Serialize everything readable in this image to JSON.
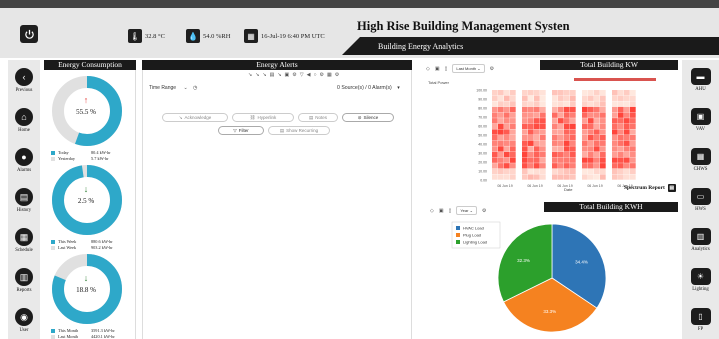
{
  "header": {
    "title": "High Rise Building Management Systen",
    "subtitle": "Building Energy Analytics",
    "temperature": "32.8 °C",
    "humidity": "54.0 %RH",
    "datetime": "16-Jul-19 6:40 PM UTC"
  },
  "left_nav": [
    {
      "label": "Previous",
      "icon": "chevron-left-icon"
    },
    {
      "label": "Home",
      "icon": "home-icon"
    },
    {
      "label": "Alarms",
      "icon": "bell-icon"
    },
    {
      "label": "History",
      "icon": "history-icon"
    },
    {
      "label": "Schedule",
      "icon": "calendar-icon"
    },
    {
      "label": "Reports",
      "icon": "reports-icon"
    },
    {
      "label": "User",
      "icon": "user-icon"
    }
  ],
  "right_nav": [
    {
      "label": "AHU",
      "icon": "ahu-icon"
    },
    {
      "label": "VAV",
      "icon": "vav-icon"
    },
    {
      "label": "CHWS",
      "icon": "chws-icon"
    },
    {
      "label": "HWS",
      "icon": "hws-icon"
    },
    {
      "label": "Analytics",
      "icon": "analytics-icon"
    },
    {
      "label": "Lighting",
      "icon": "lightbulb-icon"
    },
    {
      "label": "FP",
      "icon": "fire-panel-icon"
    }
  ],
  "energy": {
    "title": "Energy Consumption",
    "blocks": [
      {
        "percent": "55.5 %",
        "fraction": 0.555,
        "trend": "up",
        "trend_color": "#e53935",
        "rows": [
          [
            "Today",
            "80.4 kW-hr"
          ],
          [
            "Yesterday",
            "5.7 kW-hr"
          ]
        ]
      },
      {
        "percent": "2.5 %",
        "fraction": 0.975,
        "trend": "down",
        "trend_color": "#2e7d32",
        "rows": [
          [
            "This Week",
            "880.6 kW-hr"
          ],
          [
            "Last Week",
            "903.2 kW-hr"
          ]
        ]
      },
      {
        "percent": "18.8 %",
        "fraction": 0.812,
        "trend": "down",
        "trend_color": "#2e7d32",
        "rows": [
          [
            "This Month",
            "3591.3 kW-hr"
          ],
          [
            "Last Month",
            "4420.1 kW-hr"
          ]
        ]
      }
    ],
    "colors": {
      "current": "#2ea8c9",
      "previous": "#e0e0e0"
    }
  },
  "alerts": {
    "title": "Energy Alerts",
    "time_range_label": "Time Range",
    "sources_text": "0 Source(s) / 0 Alarm(s)",
    "buttons": {
      "acknowledge": "Acknowledge",
      "hyperlink": "Hyperlink",
      "notes": "Notes",
      "silence": "Silence",
      "filter": "Filter",
      "show_recurring": "Show Recurring"
    }
  },
  "kw_chart": {
    "title": "Total Building KW",
    "range_select": "Last Month",
    "series_label": "Total Power",
    "y_ticks": [
      "100.00",
      "90.00",
      "80.00",
      "70.00",
      "60.00",
      "50.00",
      "40.00",
      "30.00",
      "20.00",
      "10.00",
      "0.00"
    ],
    "x_ticks": [
      "06 Jun 19",
      "06 Jun 19",
      "06 Jun 19",
      "06 Jun 19",
      "06 Jun 19"
    ],
    "x_axis_label": "Date",
    "spectrum_label": "Spectrum Report"
  },
  "kwh_chart": {
    "title": "Total Building KWH",
    "range_select": "Year",
    "chart_data": {
      "type": "pie",
      "categories": [
        "HVAC Load",
        "Plug Load",
        "Lighting Load"
      ],
      "values": [
        34.4,
        33.3,
        32.3
      ],
      "labels": [
        "34.4%",
        "33.3%",
        "32.3%"
      ],
      "colors": [
        "#2e75b6",
        "#f58220",
        "#2ca02c"
      ]
    }
  }
}
